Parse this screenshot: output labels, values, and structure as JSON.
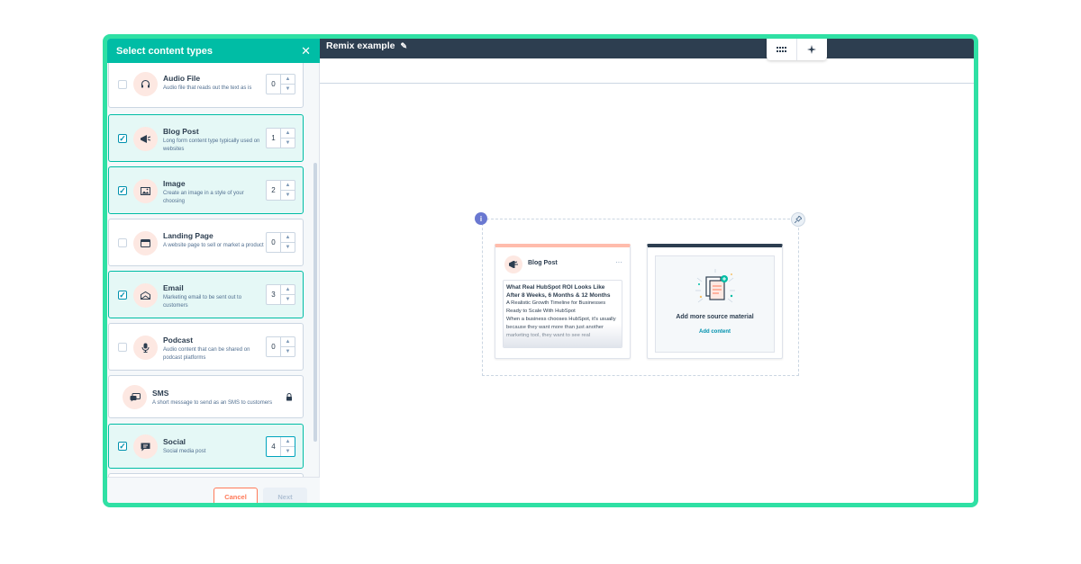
{
  "panel": {
    "title": "Select content types",
    "items": [
      {
        "name": "Audio File",
        "desc": "Audio file that reads out the text as is",
        "count": "0",
        "selected": false,
        "icon": "headphones-icon"
      },
      {
        "name": "Blog Post",
        "desc": "Long form content type typically used on websites",
        "count": "1",
        "selected": true,
        "icon": "megaphone-icon"
      },
      {
        "name": "Image",
        "desc": "Create an image in a style of your choosing",
        "count": "2",
        "selected": true,
        "icon": "image-icon"
      },
      {
        "name": "Landing Page",
        "desc": "A website page to sell or market a product",
        "count": "0",
        "selected": false,
        "icon": "browser-icon"
      },
      {
        "name": "Email",
        "desc": "Marketing email to be sent out to customers",
        "count": "3",
        "selected": true,
        "icon": "envelope-icon"
      },
      {
        "name": "Podcast",
        "desc": "Audio content that can be shared on podcast platforms",
        "count": "0",
        "selected": false,
        "icon": "microphone-icon"
      },
      {
        "name": "SMS",
        "desc": "A short message to send as an SMS to customers",
        "locked": true,
        "icon": "chat-icon"
      },
      {
        "name": "Social",
        "desc": "Social media post",
        "count": "4",
        "selected": true,
        "icon": "speech-bubble-icon"
      }
    ],
    "cancel_label": "Cancel",
    "next_label": "Next"
  },
  "header": {
    "title": "Remix example"
  },
  "canvas": {
    "blog_card": {
      "label": "Blog Post",
      "title": "What Real HubSpot ROI Looks Like After 8 Weeks, 6 Months & 12 Months",
      "subtitle": "A Realistic Growth Timeline for Businesses Ready to Scale With HubSpot",
      "body": "When a business chooses HubSpot, it's usually because they want more than just another marketing tool, they want to see real"
    },
    "add_card": {
      "title": "Add more source material",
      "link": "Add content"
    }
  },
  "colors": {
    "accent": "#00bda5",
    "frame": "#2fe0a4",
    "header_bg": "#2d3e50",
    "cancel": "#ff7a59"
  }
}
